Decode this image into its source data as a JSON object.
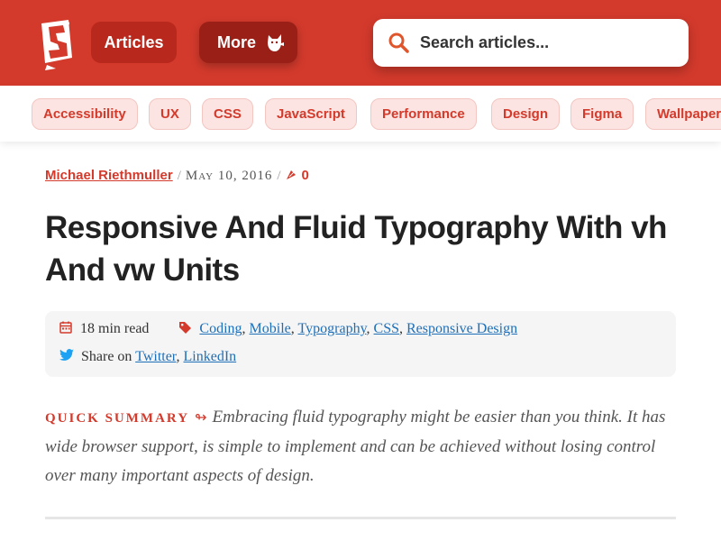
{
  "header": {
    "nav": {
      "articles_label": "Articles",
      "more_label": "More"
    },
    "search": {
      "placeholder": "Search articles..."
    },
    "brand_color": "#d33a2c"
  },
  "tags": [
    "Accessibility",
    "UX",
    "CSS",
    "JavaScript",
    "Performance",
    "Design",
    "Figma",
    "Wallpapers"
  ],
  "article": {
    "author": "Michael Riethmuller",
    "date": "May 10, 2016",
    "comments_count": "0",
    "title": "Responsive And Fluid Typography With vh And vw Units",
    "read_time": "18 min read",
    "categories": [
      "Coding",
      "Mobile",
      "Typography",
      "CSS",
      "Responsive Design"
    ],
    "share_label": "Share on",
    "share_links": [
      "Twitter",
      "LinkedIn"
    ],
    "summary_label": "Quick Summary",
    "summary_arrow": "↬",
    "summary_text": "Embracing fluid typography might be easier than you think. It has wide browser support, is simple to implement and can be achieved without losing control over many important aspects of design."
  }
}
